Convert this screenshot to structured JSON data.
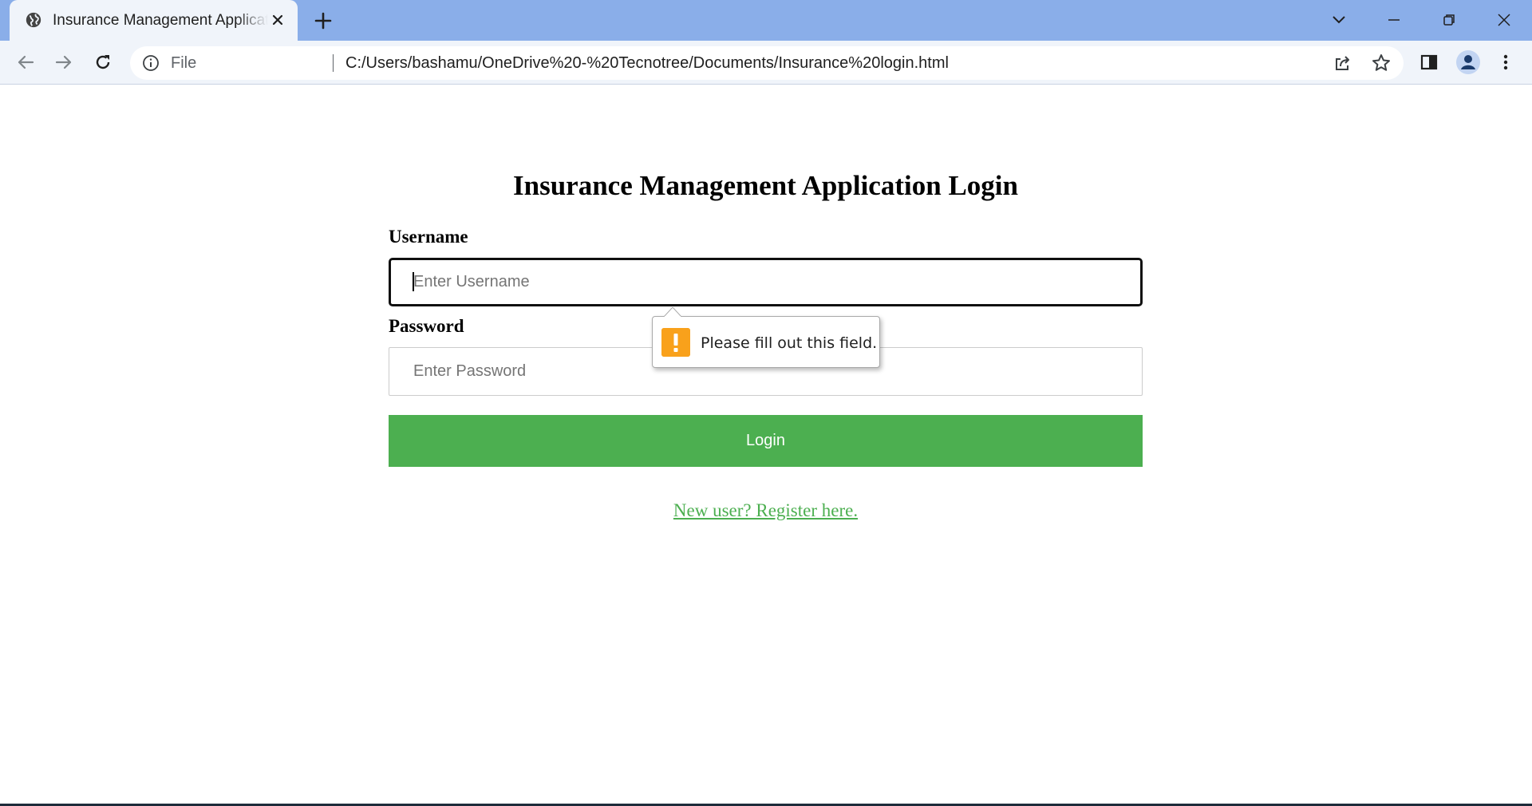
{
  "browser": {
    "tab": {
      "title": "Insurance Management Application Login",
      "favicon": "globe-icon",
      "close_icon": "close-icon"
    },
    "new_tab_icon": "plus-icon",
    "window_controls": [
      "tab-search-icon",
      "minimize-icon",
      "restore-icon",
      "close-icon"
    ],
    "toolbar": {
      "back_icon": "arrow-left-icon",
      "forward_icon": "arrow-right-icon",
      "reload_icon": "reload-icon",
      "site_info_icon": "info-icon",
      "scheme_label": "File",
      "url": "C:/Users/bashamu/OneDrive%20-%20Tecnotree/Documents/Insurance%20login.html",
      "actions": [
        "share-icon",
        "star-icon",
        "side-panel-icon",
        "profile-icon",
        "kebab-menu-icon"
      ]
    },
    "colors": {
      "tabstrip": "#8aaee9",
      "toolbar": "#f0f4fa"
    }
  },
  "page": {
    "title": "Insurance Management Application Login",
    "username": {
      "label": "Username",
      "placeholder": "Enter Username",
      "value": ""
    },
    "password": {
      "label": "Password",
      "placeholder": "Enter Password",
      "value": ""
    },
    "login_button": "Login",
    "register_link": "New user? Register here.",
    "validation": {
      "icon": "warning-icon",
      "message": "Please fill out this field."
    },
    "colors": {
      "accent": "#4caf50",
      "warning": "#f9a11b"
    }
  }
}
